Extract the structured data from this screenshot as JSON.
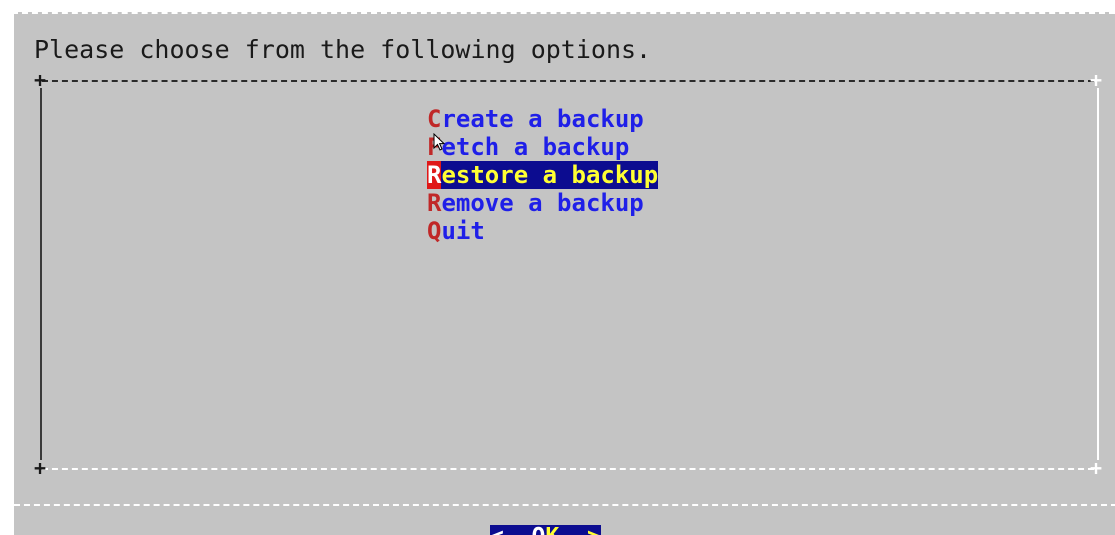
{
  "dialog": {
    "prompt": "Please choose from the following options."
  },
  "menu": {
    "items": [
      {
        "hotkey": "C",
        "label": "reate a backup",
        "selected": false
      },
      {
        "hotkey": "F",
        "label": "etch a backup",
        "selected": false
      },
      {
        "hotkey": "R",
        "label": "estore a backup",
        "selected": true
      },
      {
        "hotkey": "R",
        "label": "emove a backup",
        "selected": false
      },
      {
        "hotkey": "Q",
        "label": "uit",
        "selected": false
      }
    ]
  },
  "buttons": {
    "ok_left": "<  ",
    "ok_hotkey": "O",
    "ok_label": "K  >"
  },
  "colors": {
    "background": "#c4c4c4",
    "item_text": "#1f1fe8",
    "hotkey": "#c02828",
    "selection_bg": "#0c0c90",
    "selection_text": "#ffff33"
  },
  "icons": {
    "pointer": "mouse-pointer-icon"
  }
}
